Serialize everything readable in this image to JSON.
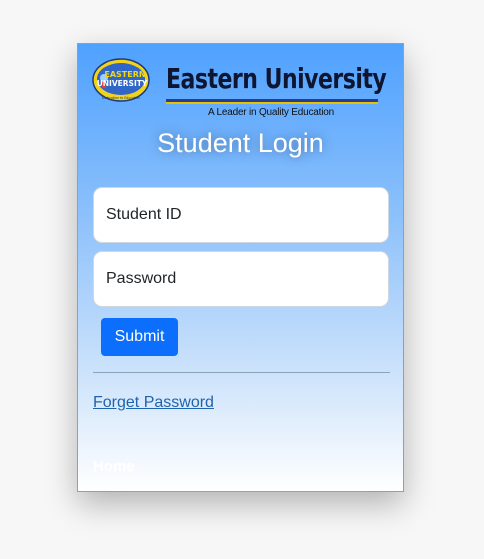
{
  "brand": {
    "seal_text": "EASTERN UNIVERSITY",
    "seal_motto": "Dedication to Education",
    "name": "Eastern University",
    "tagline": "A Leader in Quality Education"
  },
  "login": {
    "title": "Student Login",
    "student_id_placeholder": "Student ID",
    "password_placeholder": "Password",
    "submit_label": "Submit",
    "forget_label": "Forget Password",
    "home_label": "Home"
  },
  "colors": {
    "card_top": "#4fa1ff",
    "card_bottom": "#ffffff",
    "button": "#0b6efd",
    "link": "#1f63ad"
  }
}
